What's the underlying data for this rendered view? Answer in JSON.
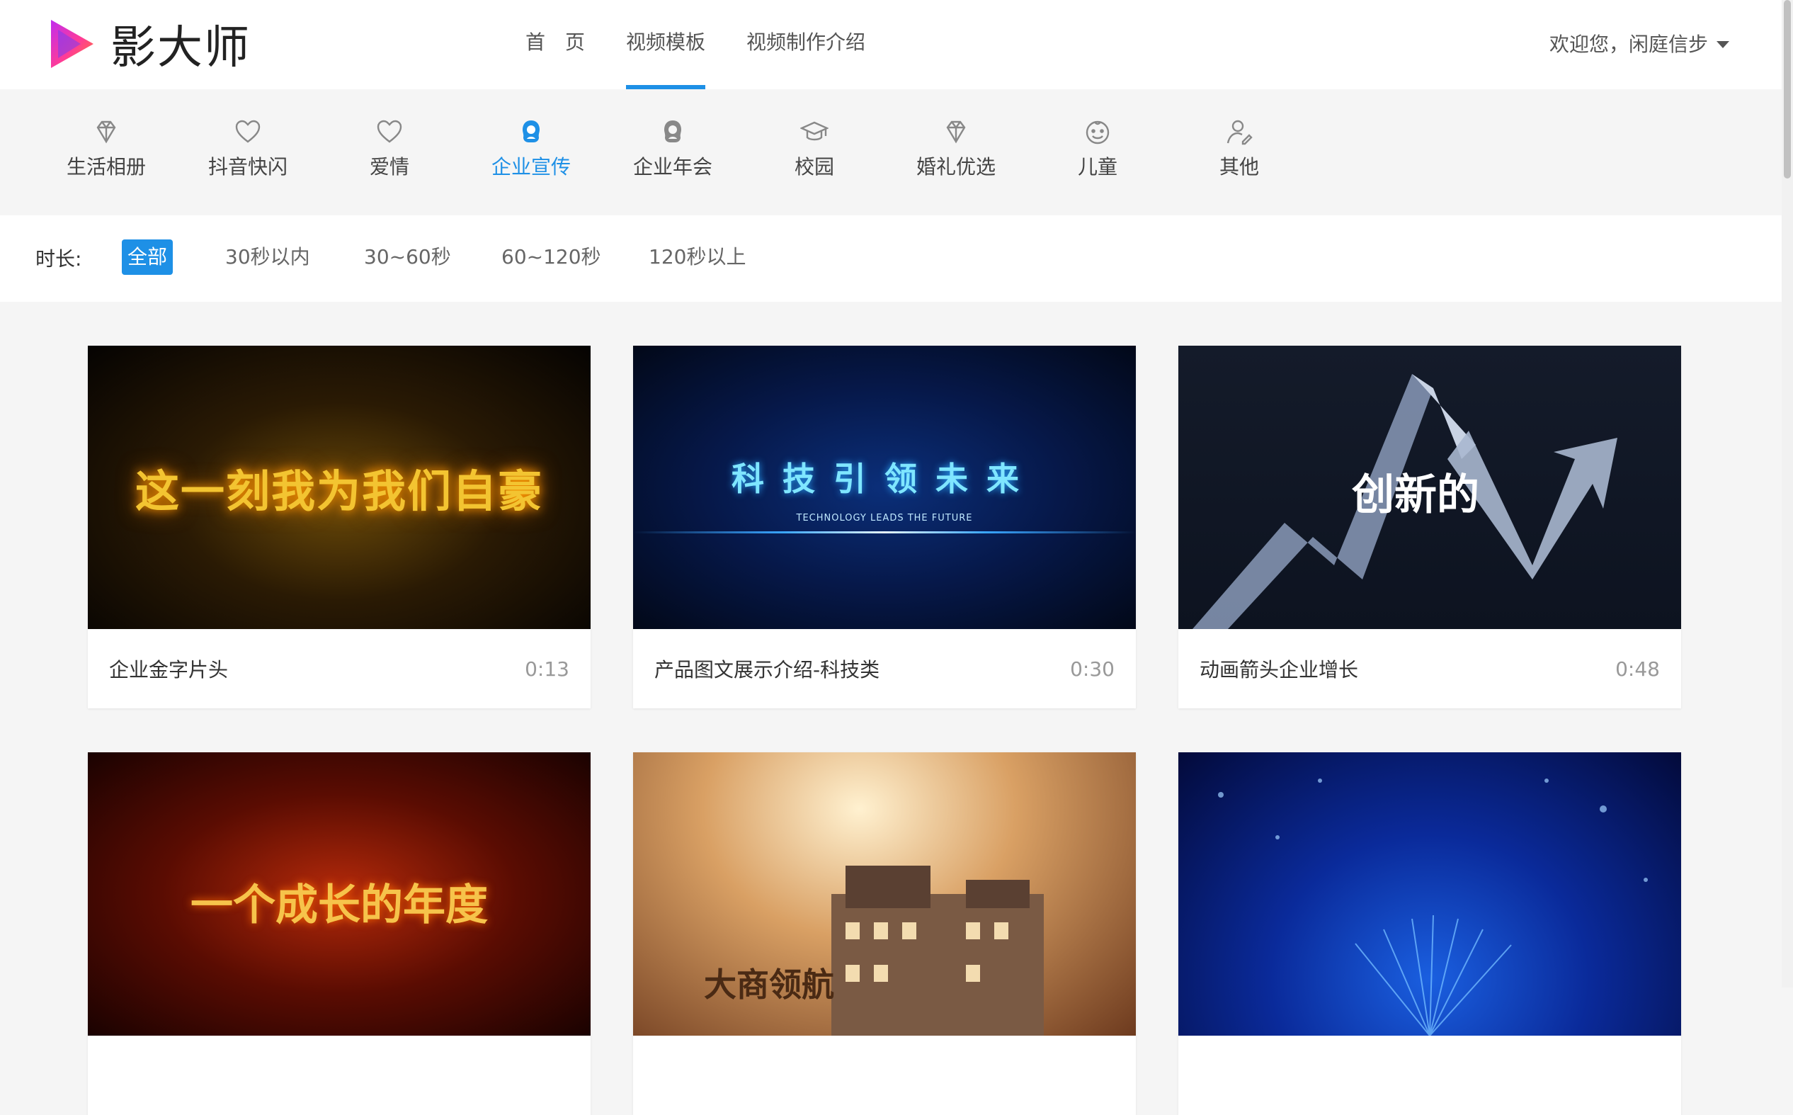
{
  "app": {
    "logo_text": "影大师"
  },
  "nav": {
    "items": [
      {
        "label": "首页"
      },
      {
        "label": "视频模板"
      },
      {
        "label": "视频制作介绍"
      }
    ],
    "active_index": 1
  },
  "user": {
    "greeting": "欢迎您，闲庭信步"
  },
  "categories": {
    "items": [
      {
        "label": "生活相册",
        "icon": "diamond-icon"
      },
      {
        "label": "抖音快闪",
        "icon": "heart-icon"
      },
      {
        "label": "爱情",
        "icon": "heart-icon"
      },
      {
        "label": "企业宣传",
        "icon": "business-person-icon"
      },
      {
        "label": "企业年会",
        "icon": "business-person-icon"
      },
      {
        "label": "校园",
        "icon": "graduation-cap-icon"
      },
      {
        "label": "婚礼优选",
        "icon": "diamond-icon"
      },
      {
        "label": "儿童",
        "icon": "child-face-icon"
      },
      {
        "label": "其他",
        "icon": "person-edit-icon"
      }
    ],
    "active_index": 3
  },
  "filter": {
    "label": "时长:",
    "options": [
      "全部",
      "30秒以内",
      "30~60秒",
      "60~120秒",
      "120秒以上"
    ],
    "active_index": 0
  },
  "templates": [
    {
      "name": "企业金字片头",
      "duration": "0:13",
      "thumb_text": "这一刻我为我们自豪"
    },
    {
      "name": "产品图文展示介绍-科技类",
      "duration": "0:30",
      "thumb_text": "科技引领未来",
      "thumb_subtext": "TECHNOLOGY LEADS THE FUTURE"
    },
    {
      "name": "动画箭头企业增长",
      "duration": "0:48",
      "thumb_text": "创新的"
    },
    {
      "name": "",
      "duration": "",
      "thumb_text": "一个成长的年度"
    },
    {
      "name": "",
      "duration": "",
      "thumb_text": "大商领航"
    },
    {
      "name": "",
      "duration": "",
      "thumb_text": ""
    }
  ],
  "colors": {
    "accent": "#1e90e6"
  }
}
